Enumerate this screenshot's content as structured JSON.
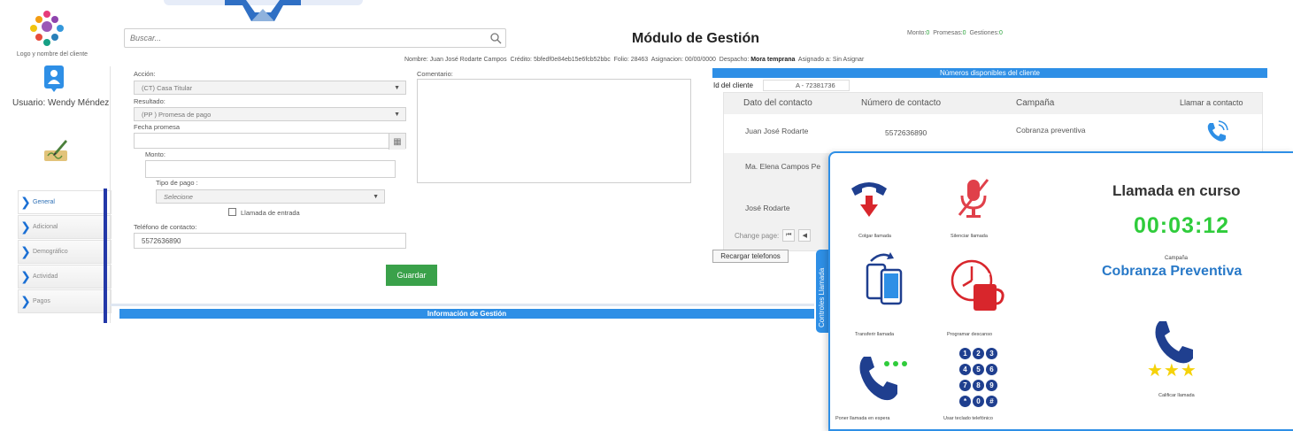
{
  "sidebar": {
    "logo_text": "Logo y nombre del cliente",
    "user_label": "Usuario: Wendy Méndez",
    "nav": [
      {
        "label": "General",
        "active": true
      },
      {
        "label": "Adicional"
      },
      {
        "label": "Demográfico"
      },
      {
        "label": "Actividad"
      },
      {
        "label": "Pagos"
      }
    ]
  },
  "header": {
    "search_placeholder": "Buscar...",
    "title": "Módulo de Gestión",
    "stats": {
      "monto_label": "Monto:",
      "monto": "0",
      "promesas_label": "Promesas:",
      "promesas": "0",
      "gestiones_label": "Gestiones:",
      "gestiones": "0"
    },
    "info": {
      "nombre_label": "Nombre:",
      "nombre": "Juan José Rodarte Campos",
      "credito_label": "Crédito:",
      "credito": "5bfedf0e84eb15e6fcb52bbc",
      "folio_label": "Folio:",
      "folio": "28463",
      "asignacion_label": "Asignacion:",
      "asignacion": "00/00/0000",
      "despacho_label": "Despacho:",
      "despacho": "Mora temprana",
      "asignado_label": "Asignado a:",
      "asignado": "Sin Asignar"
    }
  },
  "form": {
    "accion_label": "Acción:",
    "accion_value": "(CT) Casa Titular",
    "resultado_label": "Resultado:",
    "resultado_value": "(PP  ) Promesa de pago",
    "fecha_label": "Fecha promesa",
    "monto_label": "Monto:",
    "tipo_pago_label": "Tipo de pago :",
    "tipo_pago_value": "Selecione",
    "llamada_entrada_label": "Llamada de entrada",
    "telefono_label": "Teléfono de contacto:",
    "telefono_value": "5572636890",
    "comentario_label": "Comentario:",
    "guardar_label": "Guardar",
    "info_gestion": "Información de Gestión"
  },
  "contacts": {
    "bar_title": "Números disponibles del cliente",
    "id_label": "Id del cliente",
    "id_value": "A - 72381736",
    "headers": [
      "Dato del contacto",
      "Número de contacto",
      "Campaña",
      "Llamar a contacto"
    ],
    "rows": [
      {
        "name": "Juan José  Rodarte",
        "number": "5572636890",
        "campaign": "Cobranza preventiva"
      },
      {
        "name": "Ma. Elena Campos Pe"
      },
      {
        "name": "José Rodarte"
      }
    ],
    "pager_label": "Change page:",
    "recargar_label": "Recargar telefonos"
  },
  "call": {
    "tab_label": "Controles Llamada",
    "colgar": "Colgar llamada",
    "silenciar": "Silenciar llamada",
    "transferir": "Transferir llamada",
    "descanso": "Programar descanso",
    "espera": "Poner llamada en espera",
    "teclado": "Usar teclado telefónico",
    "title": "Llamada en curso",
    "timer": "00:03:12",
    "campaign_label": "Campaña",
    "campaign": "Cobranza Preventiva",
    "calificar": "Calificar llamada",
    "keypad": [
      "1",
      "2",
      "3",
      "4",
      "5",
      "6",
      "7",
      "8",
      "9",
      "*",
      "0",
      "#"
    ]
  },
  "colors": {
    "accent_blue": "#2e8fe6",
    "dark_blue": "#1f3f8f",
    "green": "#3aa14a",
    "timer_green": "#2fcc3b",
    "red": "#d8262c"
  }
}
